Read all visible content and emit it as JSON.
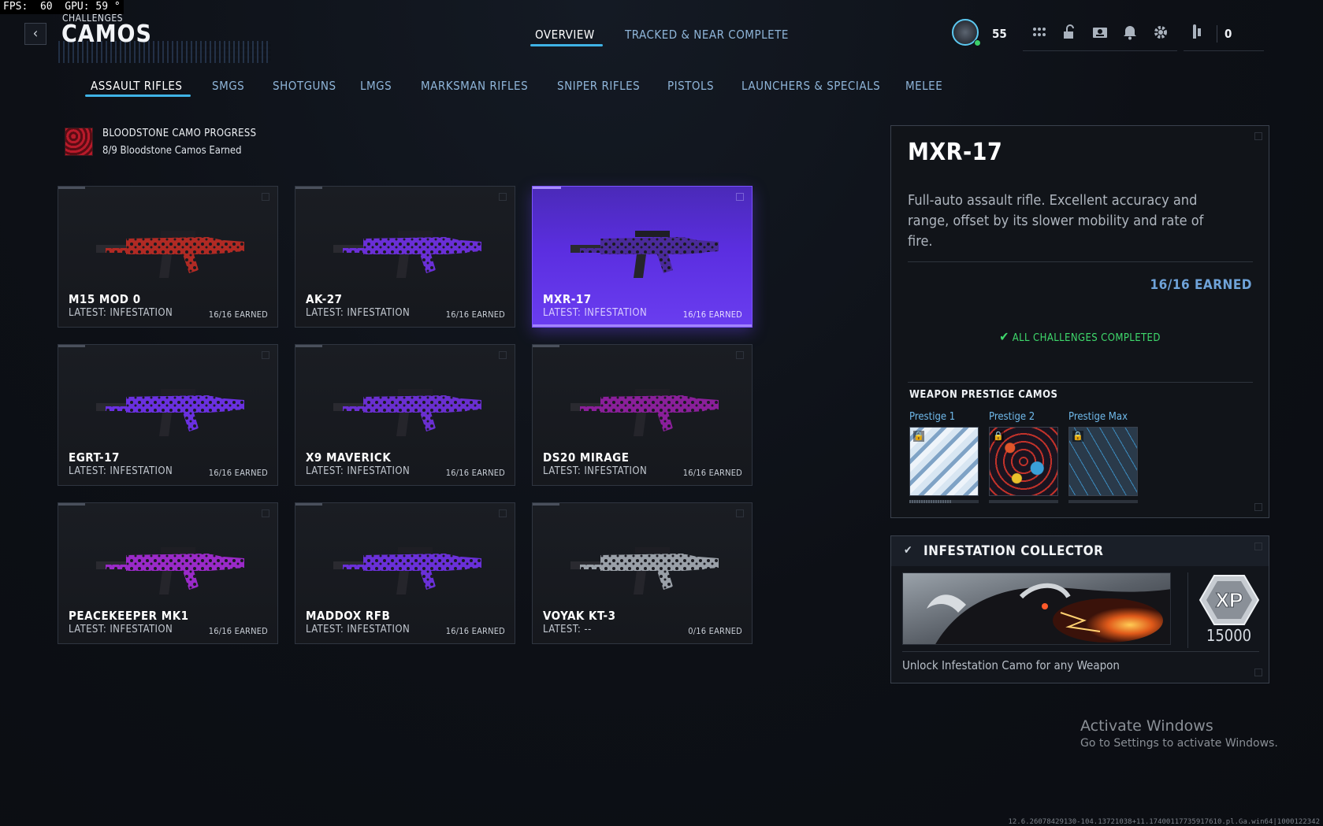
{
  "overlay": {
    "fps": "FPS:  60 ",
    "gpu": "GPU: 59 °"
  },
  "header": {
    "breadcrumb": "CHALLENGES",
    "title": "CAMOS",
    "tabs": [
      {
        "label": "OVERVIEW",
        "active": true
      },
      {
        "label": "TRACKED & NEAR COMPLETE",
        "active": false
      }
    ],
    "player_level": "55",
    "currency": "0"
  },
  "categories": [
    {
      "label": "ASSAULT RIFLES",
      "active": true
    },
    {
      "label": "SMGS"
    },
    {
      "label": "SHOTGUNS"
    },
    {
      "label": "LMGS"
    },
    {
      "label": "MARKSMAN RIFLES"
    },
    {
      "label": "SNIPER RIFLES"
    },
    {
      "label": "PISTOLS"
    },
    {
      "label": "LAUNCHERS & SPECIALS"
    },
    {
      "label": "MELEE"
    }
  ],
  "bloodstone": {
    "title": "BLOODSTONE CAMO PROGRESS",
    "subtitle": "8/9 Bloodstone Camos Earned"
  },
  "weapons": [
    {
      "name": "M15 MOD 0",
      "latest": "LATEST: INFESTATION",
      "earned": "16/16 EARNED",
      "camo": "#b02a24",
      "selected": false
    },
    {
      "name": "AK-27",
      "latest": "LATEST: INFESTATION",
      "earned": "16/16 EARNED",
      "camo": "#6a2fd6",
      "selected": false
    },
    {
      "name": "MXR-17",
      "latest": "LATEST: INFESTATION",
      "earned": "16/16 EARNED",
      "camo": "#4a2a9a",
      "selected": true
    },
    {
      "name": "EGRT-17",
      "latest": "LATEST: INFESTATION",
      "earned": "16/16 EARNED",
      "camo": "#6a30e0",
      "selected": false
    },
    {
      "name": "X9 MAVERICK",
      "latest": "LATEST: INFESTATION",
      "earned": "16/16 EARNED",
      "camo": "#6a2fd0",
      "selected": false
    },
    {
      "name": "DS20 MIRAGE",
      "latest": "LATEST: INFESTATION",
      "earned": "16/16 EARNED",
      "camo": "#8a1f9a",
      "selected": false
    },
    {
      "name": "PEACEKEEPER MK1",
      "latest": "LATEST: INFESTATION",
      "earned": "16/16 EARNED",
      "camo": "#9a2ac8",
      "selected": false
    },
    {
      "name": "MADDOX RFB",
      "latest": "LATEST: INFESTATION",
      "earned": "16/16 EARNED",
      "camo": "#6a30d8",
      "selected": false
    },
    {
      "name": "VOYAK KT-3",
      "latest": "LATEST: --",
      "earned": "0/16 EARNED",
      "camo": "#9aa0a8",
      "selected": false
    }
  ],
  "detail": {
    "name": "MXR-17",
    "description": "Full-auto assault rifle. Excellent accuracy and range, offset by its slower mobility and rate of fire.",
    "earned": "16/16 EARNED",
    "status": "ALL CHALLENGES COMPLETED",
    "prestige_title": "WEAPON PRESTIGE CAMOS",
    "prestige": [
      {
        "label": "Prestige 1",
        "progress": 0.6
      },
      {
        "label": "Prestige 2",
        "progress": 0
      },
      {
        "label": "Prestige Max",
        "progress": 0
      }
    ]
  },
  "challenge": {
    "title": "INFESTATION COLLECTOR",
    "reward_label": "XP",
    "reward_value": "15000",
    "description": "Unlock Infestation Camo for any Weapon"
  },
  "watermark": {
    "title": "Activate Windows",
    "subtitle": "Go to Settings to activate Windows."
  },
  "build_string": "12.6.26078429130-104.13721038+11.17400117735917610.pl.Ga.win64|1000122342"
}
